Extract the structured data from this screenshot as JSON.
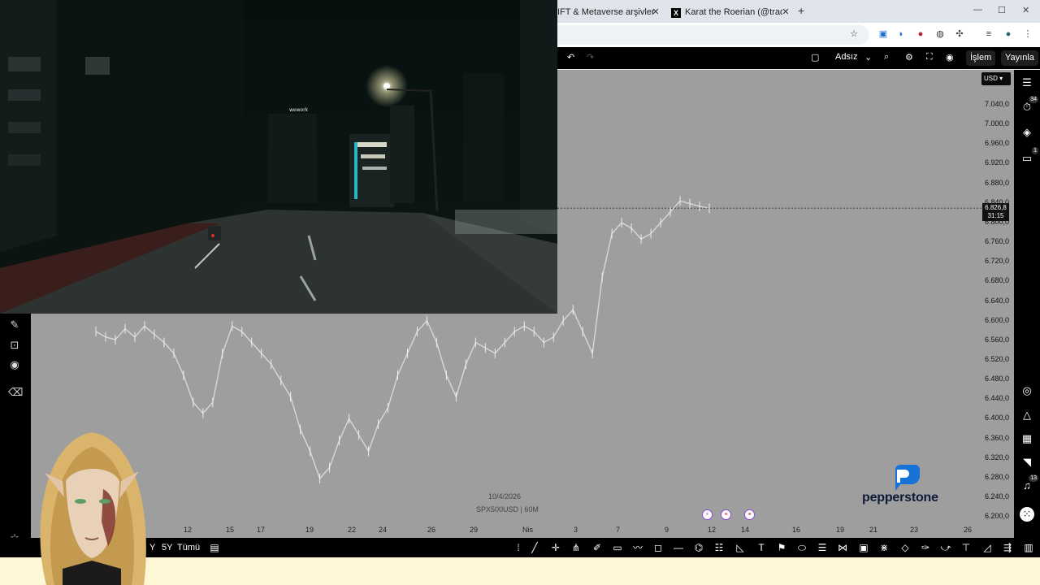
{
  "browser": {
    "tabs": [
      {
        "title": "IFT & Metaverse arşivleri | Ajan",
        "icon": "page-icon"
      },
      {
        "title": "Karat the Roerian (@traderthra",
        "icon": "x-logo-icon"
      }
    ],
    "new_tab_label": "+"
  },
  "tv_top": {
    "layout_name": "Adsız",
    "trade_button": "İşlem",
    "publish_button": "Yayınla"
  },
  "chart": {
    "currency": "USD",
    "current_price": "6.826,8",
    "countdown": "31:15",
    "price_ticks": [
      "7.040,0",
      "7.000,0",
      "6.960,0",
      "6.920,0",
      "6.880,0",
      "6.840,0",
      "6.800,0",
      "6.760,0",
      "6.720,0",
      "6.680,0",
      "6.640,0",
      "6.600,0",
      "6.560,0",
      "6.520,0",
      "6.480,0",
      "6.440,0",
      "6.400,0",
      "6.360,0",
      "6.320,0",
      "6.280,0",
      "6.240,0",
      "6.200,0"
    ],
    "time_ticks": [
      "12",
      "15",
      "17",
      "19",
      "22",
      "24",
      "26",
      "29",
      "Nis",
      "3",
      "7",
      "9",
      "12",
      "14",
      "16",
      "19",
      "21",
      "23",
      "26"
    ],
    "date_label": "10/4/2026",
    "symbol_label": "SPX500USD | 60M",
    "brand": "pepperstone"
  },
  "chart_data": {
    "type": "line",
    "title": "",
    "series": [
      {
        "values": [
          6600,
          6590,
          6585,
          6605,
          6590,
          6610,
          6595,
          6580,
          6560,
          6520,
          6470,
          6450,
          6470,
          6560,
          6610,
          6600,
          6580,
          6560,
          6540,
          6510,
          6480,
          6420,
          6380,
          6330,
          6350,
          6400,
          6440,
          6410,
          6380,
          6430,
          6460,
          6520,
          6560,
          6600,
          6620,
          6580,
          6520,
          6480,
          6540,
          6580,
          6570,
          6560,
          6580,
          6600,
          6610,
          6600,
          6580,
          6590,
          6620,
          6640,
          6600,
          6560,
          6700,
          6780,
          6800,
          6790,
          6770,
          6780,
          6800,
          6820,
          6840,
          6835,
          6830,
          6826.8
        ]
      }
    ],
    "ylim": [
      6200,
      7060
    ],
    "currency": "USD"
  },
  "tv_bottom": {
    "range_partial": "Y",
    "range_5y": "5Y",
    "range_all": "Tümü"
  },
  "right_bar": {
    "alerts_badge": "34",
    "chat_badge": "1",
    "notif_badge": "13"
  }
}
